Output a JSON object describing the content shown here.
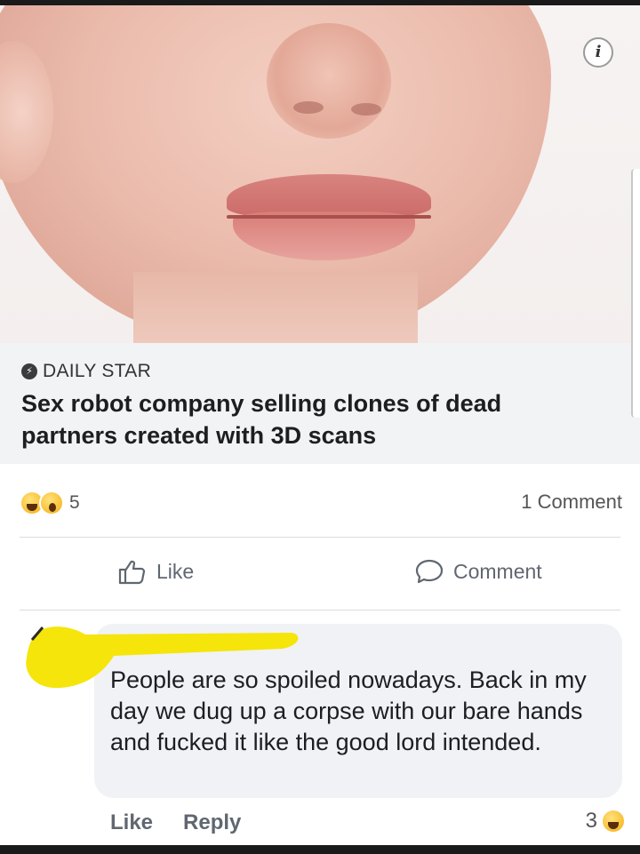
{
  "post": {
    "source": "DAILY STAR",
    "headline": "Sex robot company selling clones of dead partners created with 3D scans",
    "info_icon": "i"
  },
  "stats": {
    "reaction_count": "5",
    "comment_count": "1 Comment",
    "reaction_icons": [
      "haha-emoji",
      "wow-emoji"
    ]
  },
  "actions": {
    "like_label": "Like",
    "comment_label": "Comment"
  },
  "comment": {
    "text": "People are so spoiled nowadays. Back in my day we dug up a corpse with our bare hands and fucked it like the good lord intended.",
    "like_label": "Like",
    "reply_label": "Reply",
    "reaction_count": "3"
  },
  "colors": {
    "caption_bg": "#f2f3f5",
    "bubble_bg": "#f0f2f5",
    "redaction": "#f5e50a",
    "reaction_yellow": "#f7b928"
  }
}
